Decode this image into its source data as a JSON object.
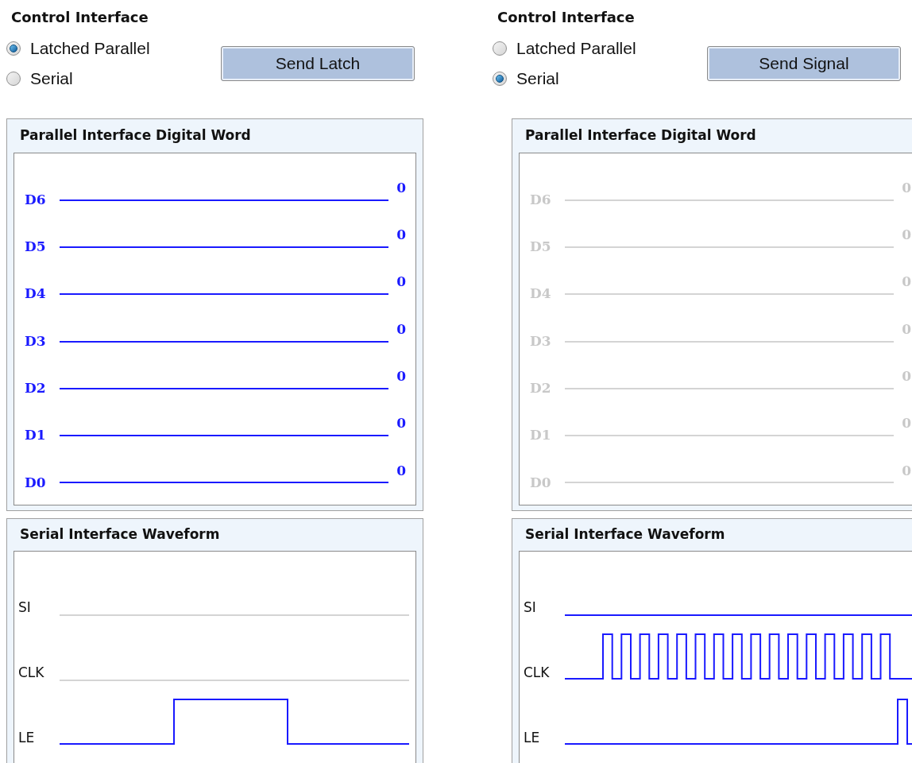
{
  "panels": [
    {
      "title": "Control Interface",
      "modes": [
        {
          "label": "Latched Parallel",
          "selected": true
        },
        {
          "label": "Serial",
          "selected": false
        }
      ],
      "button": "Send Latch",
      "parallel": {
        "title": "Parallel Interface Digital Word",
        "active": true,
        "bits": [
          {
            "name": "D6",
            "value": "0"
          },
          {
            "name": "D5",
            "value": "0"
          },
          {
            "name": "D4",
            "value": "0"
          },
          {
            "name": "D3",
            "value": "0"
          },
          {
            "name": "D2",
            "value": "0"
          },
          {
            "name": "D1",
            "value": "0"
          },
          {
            "name": "D0",
            "value": "0"
          }
        ]
      },
      "serial": {
        "title": "Serial Interface Waveform",
        "signals": [
          {
            "name": "SI",
            "kind": "flat",
            "active": false
          },
          {
            "name": "CLK",
            "kind": "flat",
            "active": false
          },
          {
            "name": "LE",
            "kind": "pulse",
            "active": true
          }
        ]
      }
    },
    {
      "title": "Control Interface",
      "modes": [
        {
          "label": "Latched Parallel",
          "selected": false
        },
        {
          "label": "Serial",
          "selected": true
        }
      ],
      "button": "Send Signal",
      "parallel": {
        "title": "Parallel Interface Digital Word",
        "active": false,
        "bits": [
          {
            "name": "D6",
            "value": "0"
          },
          {
            "name": "D5",
            "value": "0"
          },
          {
            "name": "D4",
            "value": "0"
          },
          {
            "name": "D3",
            "value": "0"
          },
          {
            "name": "D2",
            "value": "0"
          },
          {
            "name": "D1",
            "value": "0"
          },
          {
            "name": "D0",
            "value": "0"
          }
        ]
      },
      "serial": {
        "title": "Serial Interface Waveform",
        "signals": [
          {
            "name": "SI",
            "kind": "flat",
            "active": true
          },
          {
            "name": "CLK",
            "kind": "clock",
            "active": true
          },
          {
            "name": "LE",
            "kind": "strobe",
            "active": true
          }
        ]
      }
    }
  ]
}
